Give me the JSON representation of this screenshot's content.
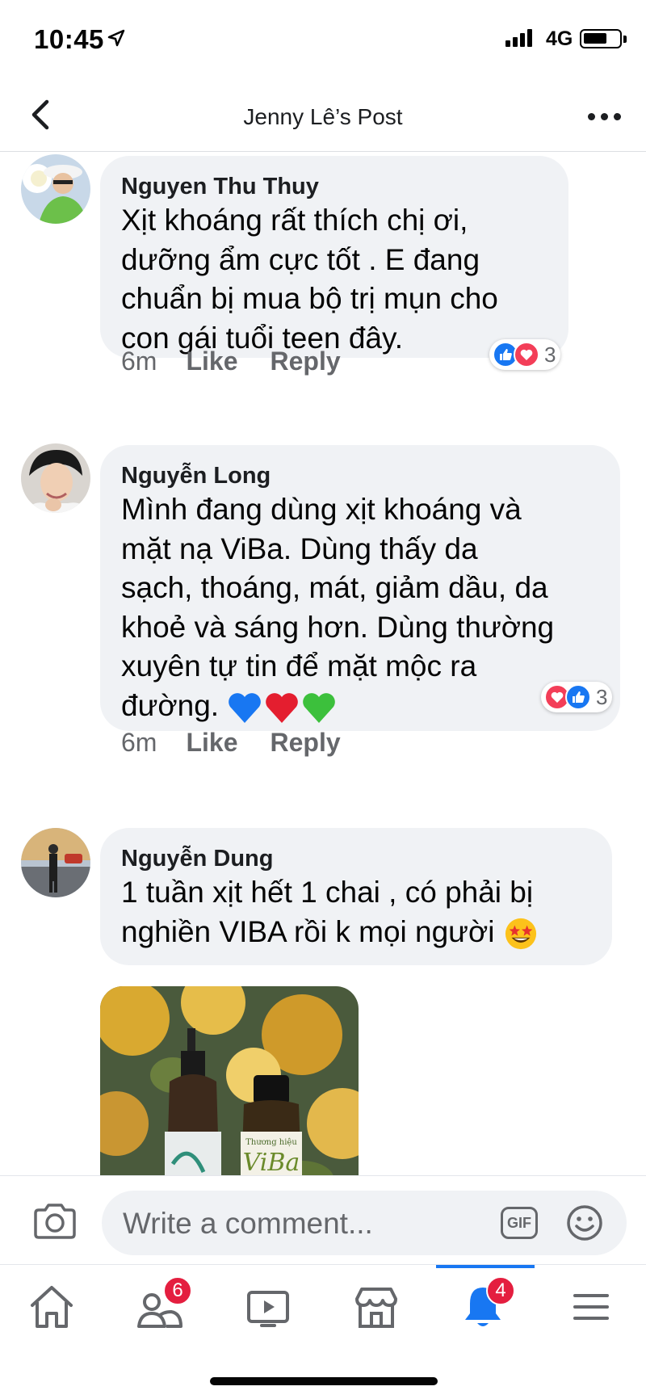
{
  "status_bar": {
    "time": "10:45",
    "network": "4G"
  },
  "header": {
    "title": "Jenny Lê’s Post"
  },
  "comments": [
    {
      "author": "Nguyen Thu Thuy",
      "lines": [
        "Xịt khoáng rất thích chị ơi,",
        "dưỡng ẩm cực tốt . E đang",
        "chuẩn bị mua bộ trị mụn cho",
        "con gái tuổi teen đây."
      ],
      "time": "6m",
      "like": "Like",
      "reply": "Reply",
      "reactions": [
        "like",
        "love"
      ],
      "reaction_count": "3"
    },
    {
      "author": "Nguyễn Long",
      "lines": [
        "Mình đang dùng xịt khoáng và",
        "mặt nạ ViBa. Dùng thấy da",
        "sạch, thoáng, mát, giảm dầu, da",
        "khoẻ và sáng hơn. Dùng thường",
        "xuyên tự tin để mặt mộc ra",
        "đường."
      ],
      "trailing_emoji": [
        "blue-heart",
        "red-heart",
        "green-heart"
      ],
      "time": "6m",
      "like": "Like",
      "reply": "Reply",
      "reactions": [
        "love",
        "like"
      ],
      "reaction_count": "3"
    },
    {
      "author": "Nguyễn Dung",
      "lines": [
        "1 tuần xịt hết 1 chai , có phải bị",
        "nghiền  VIBA rồi k mọi người"
      ],
      "trailing_emoji": [
        "star-struck"
      ],
      "photo": {
        "product_label": "ViBa",
        "brand_top": "Thương hiệu"
      }
    }
  ],
  "write_bar": {
    "placeholder": "Write a comment...",
    "gif_label": "GIF"
  },
  "tab_bar": {
    "active": "notifications",
    "tabs": [
      {
        "name": "home"
      },
      {
        "name": "friends",
        "badge": "6"
      },
      {
        "name": "watch"
      },
      {
        "name": "marketplace"
      },
      {
        "name": "notifications",
        "badge": "4"
      },
      {
        "name": "menu"
      }
    ]
  },
  "colors": {
    "accent": "#1877f2",
    "badge": "#e41e3f",
    "bubble": "#f0f2f5",
    "muted": "#65676b"
  }
}
